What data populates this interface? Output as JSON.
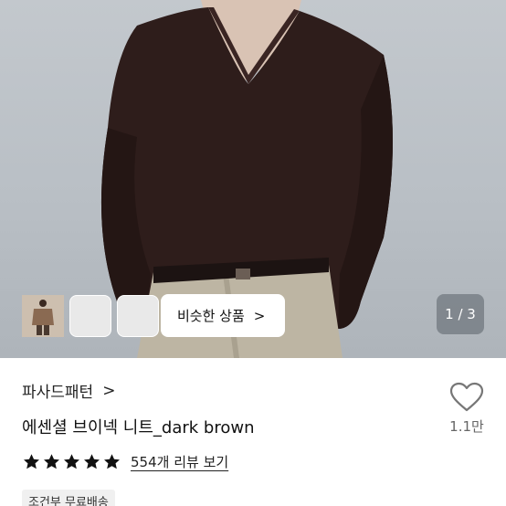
{
  "gallery": {
    "similar_button_label": "비슷한 상품",
    "chevron": ">",
    "counter": "1 / 3",
    "thumbnails": [
      "thumbnail-grey-sweater",
      "thumbnail-burgundy-sweater",
      "thumbnail-brown-sweater"
    ]
  },
  "shop": {
    "name": "파사드패턴",
    "chevron": ">"
  },
  "product": {
    "title": "에센셜 브이넥 니트_dark brown"
  },
  "rating": {
    "stars": 5,
    "review_link": "554개 리뷰 보기"
  },
  "like": {
    "count": "1.1만"
  },
  "shipping_badge": "조건부 무료배송",
  "colors": {
    "sweater": "#2d1c1a",
    "background": "#bcc2c7",
    "star": "#111111",
    "counter_bg": "#5a6068"
  }
}
